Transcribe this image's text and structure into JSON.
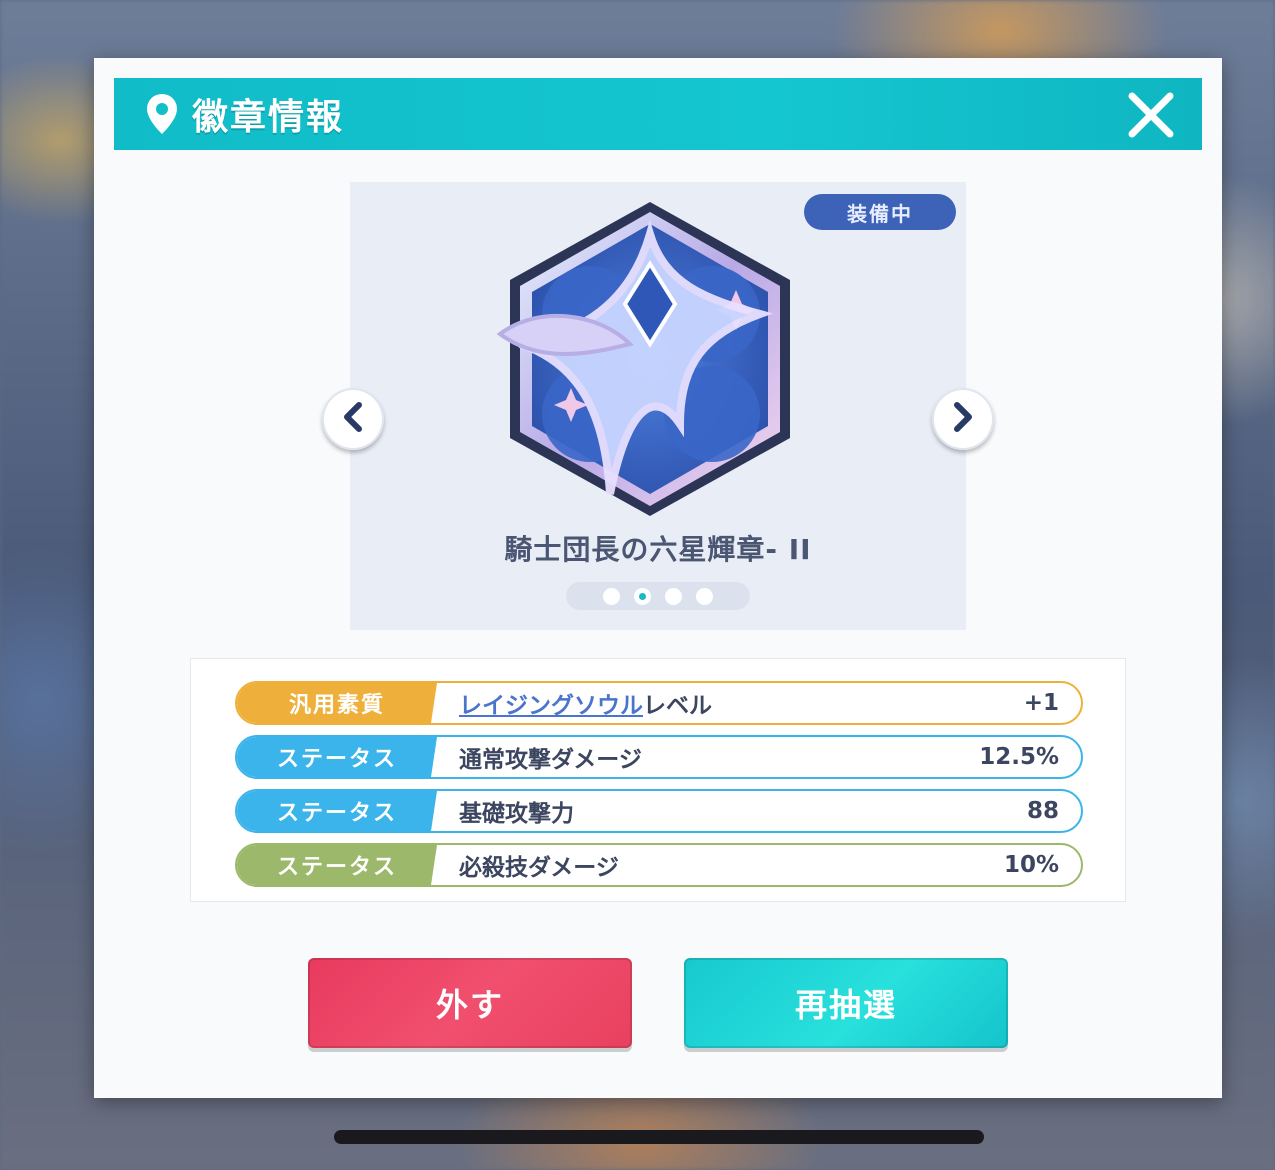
{
  "header": {
    "icon": "location-pin-icon",
    "title": "徽章情報",
    "close_icon": "close-icon"
  },
  "preview": {
    "equipped_badge": "装備中",
    "badge_name": "騎士団長の六星輝章- II",
    "emblem_icon": "hexagon-star-emblem",
    "prev_icon": "chevron-left-icon",
    "next_icon": "chevron-right-icon",
    "pager": {
      "total": 4,
      "active_index": 1
    }
  },
  "stats": [
    {
      "tag": "汎用素質",
      "label_link": "レイジングソウル",
      "label": "レベル",
      "value": "+1",
      "color": "#eeb03a"
    },
    {
      "tag": "ステータス",
      "label_link": "",
      "label": "通常攻撃ダメージ",
      "value": "12.5%",
      "color": "#3bb4ec"
    },
    {
      "tag": "ステータス",
      "label_link": "",
      "label": "基礎攻撃力",
      "value": "88",
      "color": "#3bb4ec"
    },
    {
      "tag": "ステータス",
      "label_link": "",
      "label": "必殺技ダメージ",
      "value": "10%",
      "color": "#9cb86a"
    }
  ],
  "buttons": {
    "remove": "外す",
    "reroll": "再抽選"
  }
}
